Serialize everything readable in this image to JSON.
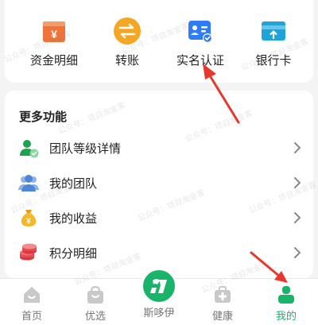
{
  "quick_actions": [
    {
      "label": "资金明细",
      "icon": "wallet-icon"
    },
    {
      "label": "转账",
      "icon": "transfer-icon"
    },
    {
      "label": "实名认证",
      "icon": "id-card-icon"
    },
    {
      "label": "银行卡",
      "icon": "bank-card-icon"
    }
  ],
  "more": {
    "title": "更多功能",
    "items": [
      {
        "label": "团队等级详情",
        "icon": "team-level-icon"
      },
      {
        "label": "我的团队",
        "icon": "team-icon"
      },
      {
        "label": "我的收益",
        "icon": "money-bag-icon"
      },
      {
        "label": "积分明细",
        "icon": "coins-icon"
      }
    ]
  },
  "tabs": [
    {
      "label": "首页",
      "icon": "home-icon"
    },
    {
      "label": "优选",
      "icon": "shopping-bag-icon"
    },
    {
      "label": "斯哆伊",
      "icon": "brand-logo-icon"
    },
    {
      "label": "健康",
      "icon": "health-kit-icon"
    },
    {
      "label": "我的",
      "icon": "profile-icon"
    }
  ],
  "active_tab": "我的",
  "watermark": "公众号：项目淘金客",
  "colors": {
    "accent_green": "#19b36a",
    "arrow_red": "#e8372c",
    "wallet_orange": "#f0733a",
    "transfer_yellow": "#f5a623",
    "id_blue": "#2f7cf6",
    "bank_teal": "#1ea4d8"
  }
}
